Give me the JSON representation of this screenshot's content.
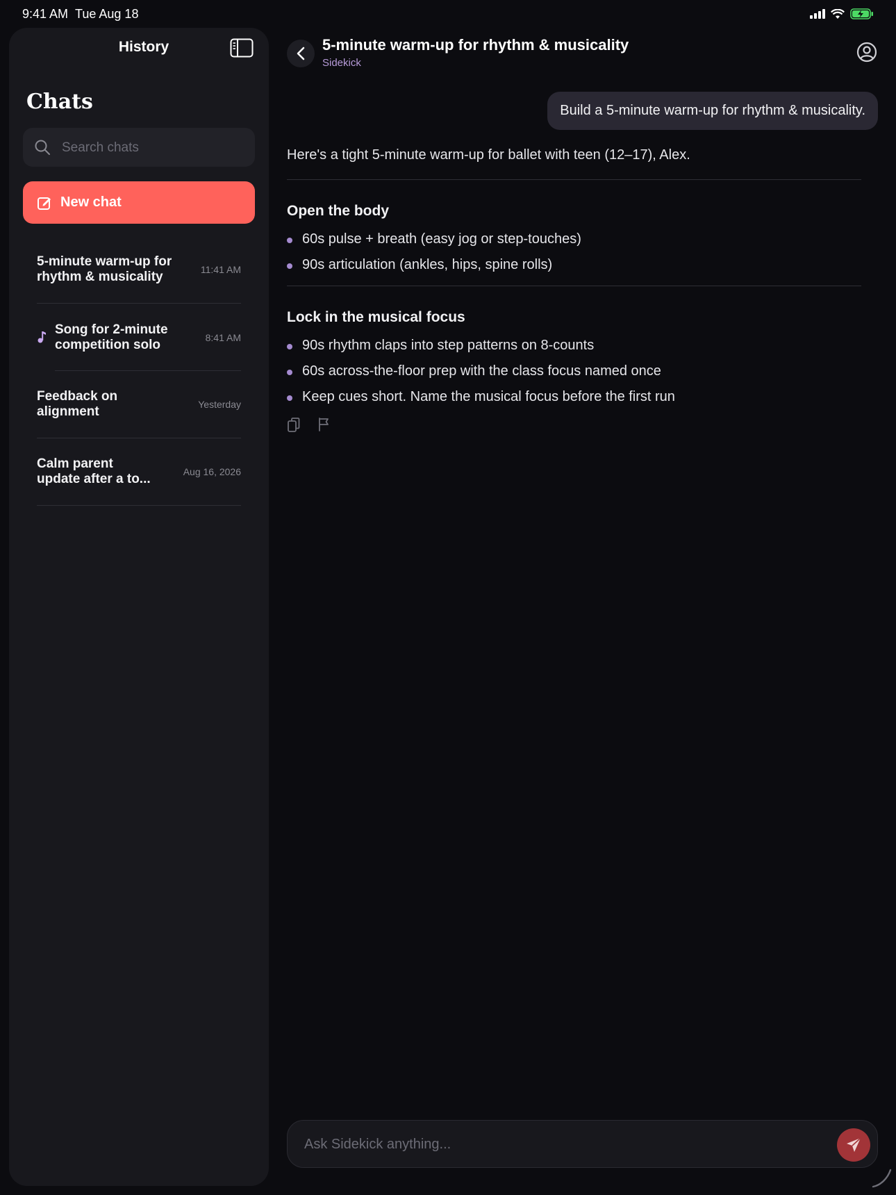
{
  "status_bar": {
    "time": "9:41 AM",
    "date": "Tue Aug 18"
  },
  "sidebar": {
    "header_title": "History",
    "section_title": "Chats",
    "search": {
      "placeholder": "Search chats",
      "value": ""
    },
    "new_chat_label": "New chat",
    "chats": [
      {
        "title": "5-minute warm-up for rhythm & musicality",
        "time": "11:41 AM",
        "icon": ""
      },
      {
        "title": "Song for 2-minute competition solo",
        "time": "8:41 AM",
        "icon": "music-note-icon"
      },
      {
        "title": "Feedback on alignment",
        "time": "Yesterday",
        "icon": ""
      },
      {
        "title": "Calm parent update after a to...",
        "time": "Aug 16, 2026",
        "icon": ""
      }
    ]
  },
  "conversation": {
    "title": "5-minute warm-up for rhythm & musicality",
    "subtitle": "Sidekick",
    "user_message": "Build a 5-minute warm-up for rhythm & musicality.",
    "assistant_intro": "Here's a tight 5-minute warm-up for ballet with teen (12–17), Alex.",
    "sections": [
      {
        "heading": "Open the body",
        "bullets": [
          "60s pulse + breath (easy jog or step-touches)",
          "90s articulation (ankles, hips, spine rolls)"
        ]
      },
      {
        "heading": "Lock in the musical focus",
        "bullets": [
          "90s rhythm claps into step patterns on 8-counts",
          "60s across-the-floor prep with the class focus named once",
          "Keep cues short. Name the musical focus before the first run"
        ]
      }
    ]
  },
  "composer": {
    "placeholder": "Ask Sidekick anything...",
    "value": ""
  },
  "colors": {
    "accent": "#ff625b",
    "send": "#a23438",
    "subtitle": "#b79bd9",
    "bullet": "#a58bd0"
  }
}
